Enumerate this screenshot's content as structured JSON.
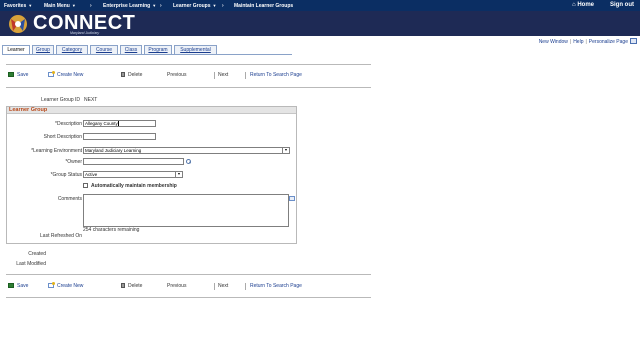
{
  "topnav": {
    "favorites": "Favorites",
    "main_menu": "Main Menu",
    "enterprise_learning": "Enterprise Learning",
    "learner_groups": "Learner Groups",
    "maintain": "Maintain Learner Groups",
    "home": "Home",
    "signout": "Sign out"
  },
  "header": {
    "brand": "CONNECT",
    "subtitle": "Maryland Judiciary"
  },
  "links": {
    "new_window": "New Window",
    "help": "Help",
    "personalize": "Personalize Page"
  },
  "tabs": [
    "Learner",
    "Group",
    "Category",
    "Course",
    "Class",
    "Program",
    "Supplemental"
  ],
  "toolbar": {
    "save": "Save",
    "create_new": "Create New",
    "delete": "Delete",
    "previous": "Previous",
    "next": "Next",
    "return": "Return To Search Page"
  },
  "form": {
    "learner_group_id_label": "Learner Group ID",
    "learner_group_id_value": "NEXT",
    "section_title": "Learner Group",
    "description_label": "*Description",
    "description_value": "Allegany County",
    "short_description_label": "Short Description",
    "short_description_value": "",
    "environment_label": "*Learning Environment",
    "environment_value": "Maryland Judiciary Learning",
    "owner_label": "*Owner",
    "owner_value": "",
    "group_status_label": "*Group Status",
    "group_status_value": "Active",
    "auto_maintain_label": "Automatically maintain membership",
    "comments_label": "Comments",
    "chars_remaining": "254 characters remaining",
    "last_refreshed_label": "Last Refreshed On",
    "created_label": "Created",
    "last_modified_label": "Last Modified"
  },
  "colors": {
    "nav_bg": "#0b2e63",
    "header_bg": "#1e2a55",
    "link": "#1a3d8f",
    "section_title": "#b8491a"
  }
}
